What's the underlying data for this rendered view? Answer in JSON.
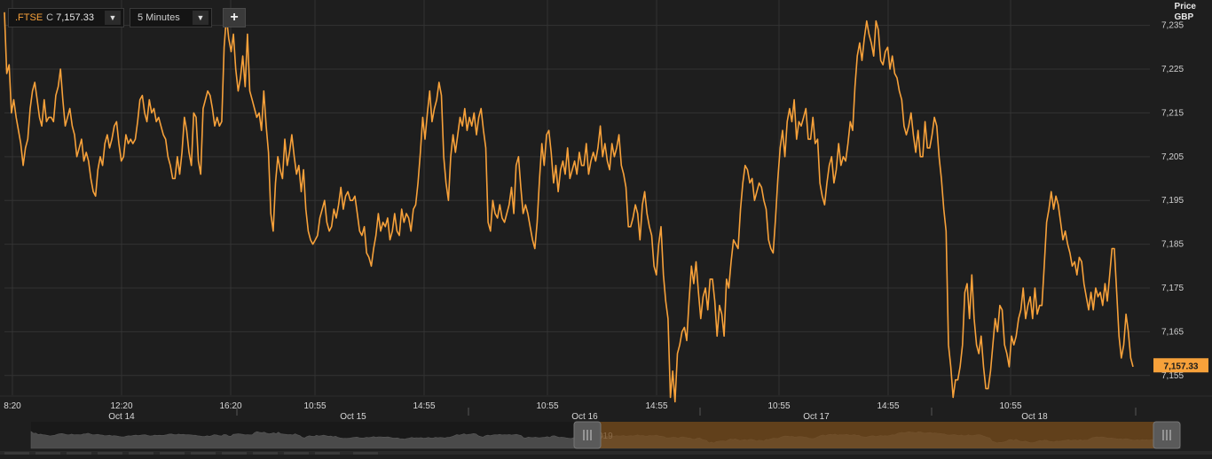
{
  "toolbar": {
    "symbol": ".FTSE",
    "close_label": "C",
    "close_value": "7,157.33",
    "interval": "5 Minutes",
    "add_icon": "plus-icon",
    "dropdown_icon": "triangle-down-icon"
  },
  "axis_header": {
    "line1": "Price",
    "line2": "GBP"
  },
  "colors": {
    "line": "#f7a13a",
    "background": "#1e1e1e",
    "grid": "#333333",
    "price_tag": "#f7a13a",
    "navigator_fill": "#7a4d1c"
  },
  "chart_data": {
    "type": "line",
    "grid": true,
    "x": [
      "08:20",
      "12:20",
      "16:20",
      "10:55",
      "14:55",
      "10:55",
      "14:55",
      "10:55",
      "14:55",
      "10:55"
    ],
    "x_tick_labels": [
      "8:20",
      "12:20",
      "16:20",
      "10:55",
      "14:55",
      "10:55",
      "14:55",
      "10:55",
      "14:55",
      "10:55"
    ],
    "x_date_labels": [
      "Oct 14",
      "Oct 15",
      "Oct 16",
      "Oct 17",
      "Oct 18"
    ],
    "yticks": [
      7155,
      7165,
      7175,
      7185,
      7195,
      7205,
      7215,
      7225,
      7235
    ],
    "ytick_labels": [
      "7,155",
      "7,165",
      "7,175",
      "7,185",
      "7,195",
      "7,205",
      "7,215",
      "7,225",
      "7,235"
    ],
    "ylim": [
      7150.5,
      7240.8
    ],
    "last_value": 7157.33,
    "last_value_label": "7,157.33",
    "series": [
      {
        "values": [
          7238,
          7224,
          7226,
          7215,
          7218,
          7214,
          7211,
          7208,
          7203,
          7207,
          7209,
          7216,
          7220,
          7222,
          7218,
          7214,
          7212,
          7218,
          7213,
          7214,
          7214,
          7213,
          7219,
          7221,
          7225,
          7218,
          7212,
          7214,
          7216,
          7212,
          7210,
          7205,
          7207,
          7209,
          7204,
          7206,
          7204,
          7200,
          7197,
          7196,
          7202,
          7205,
          7203,
          7208,
          7210,
          7207,
          7209,
          7212,
          7213,
          7208,
          7204,
          7205,
          7210,
          7208,
          7209,
          7208,
          7209,
          7213,
          7218,
          7219,
          7215,
          7213,
          7218,
          7215,
          7216,
          7213,
          7214,
          7212,
          7210,
          7209,
          7205,
          7203,
          7200,
          7200,
          7205,
          7201,
          7206,
          7214,
          7211,
          7206,
          7203,
          7215,
          7214,
          7204,
          7201,
          7216,
          7218,
          7220,
          7219,
          7216,
          7212,
          7214,
          7212,
          7213,
          7230,
          7237,
          7232,
          7229,
          7233,
          7225,
          7220,
          7223,
          7228,
          7221,
          7233,
          7220,
          7218,
          7216,
          7214,
          7215,
          7211,
          7220,
          7212,
          7206,
          7192,
          7188,
          7199,
          7205,
          7202,
          7200,
          7209,
          7203,
          7206,
          7210,
          7205,
          7201,
          7203,
          7197,
          7202,
          7193,
          7188,
          7186,
          7185,
          7186,
          7187,
          7191,
          7193,
          7195,
          7190,
          7188,
          7189,
          7193,
          7191,
          7194,
          7198,
          7193,
          7196,
          7197,
          7195,
          7195,
          7196,
          7192,
          7188,
          7187,
          7189,
          7183,
          7182,
          7180,
          7184,
          7187,
          7192,
          7188,
          7190,
          7189,
          7191,
          7186,
          7188,
          7192,
          7188,
          7187,
          7193,
          7190,
          7192,
          7191,
          7188,
          7193,
          7194,
          7199,
          7206,
          7214,
          7209,
          7215,
          7220,
          7213,
          7216,
          7218,
          7222,
          7219,
          7205,
          7199,
          7195,
          7205,
          7210,
          7206,
          7210,
          7214,
          7212,
          7216,
          7211,
          7214,
          7212,
          7215,
          7210,
          7214,
          7216,
          7211,
          7207,
          7190,
          7188,
          7195,
          7192,
          7191,
          7194,
          7191,
          7190,
          7192,
          7194,
          7198,
          7192,
          7203,
          7205,
          7198,
          7192,
          7194,
          7192,
          7189,
          7186,
          7184,
          7190,
          7200,
          7208,
          7203,
          7210,
          7211,
          7206,
          7199,
          7203,
          7197,
          7202,
          7204,
          7201,
          7207,
          7200,
          7202,
          7204,
          7201,
          7206,
          7203,
          7203,
          7208,
          7201,
          7204,
          7206,
          7204,
          7207,
          7212,
          7205,
          7208,
          7204,
          7202,
          7208,
          7205,
          7207,
          7210,
          7203,
          7201,
          7198,
          7189,
          7189,
          7191,
          7194,
          7192,
          7186,
          7194,
          7197,
          7192,
          7189,
          7187,
          7180,
          7178,
          7185,
          7189,
          7178,
          7172,
          7168,
          7150,
          7156,
          7149,
          7160,
          7162,
          7165,
          7166,
          7163,
          7172,
          7180,
          7176,
          7181,
          7174,
          7168,
          7173,
          7175,
          7170,
          7177,
          7177,
          7172,
          7164,
          7171,
          7169,
          7164,
          7177,
          7175,
          7181,
          7186,
          7185,
          7184,
          7193,
          7199,
          7203,
          7202,
          7199,
          7200,
          7195,
          7197,
          7199,
          7198,
          7195,
          7193,
          7186,
          7184,
          7183,
          7191,
          7200,
          7207,
          7211,
          7205,
          7213,
          7216,
          7213,
          7218,
          7209,
          7213,
          7212,
          7214,
          7216,
          7209,
          7209,
          7214,
          7208,
          7209,
          7199,
          7196,
          7194,
          7199,
          7203,
          7205,
          7199,
          7202,
          7208,
          7203,
          7205,
          7204,
          7208,
          7213,
          7211,
          7221,
          7228,
          7231,
          7227,
          7232,
          7236,
          7233,
          7231,
          7228,
          7236,
          7234,
          7227,
          7226,
          7229,
          7230,
          7225,
          7228,
          7224,
          7223,
          7220,
          7218,
          7212,
          7210,
          7212,
          7215,
          7210,
          7206,
          7211,
          7205,
          7205,
          7213,
          7207,
          7207,
          7210,
          7214,
          7212,
          7205,
          7200,
          7193,
          7188,
          7162,
          7157,
          7150,
          7154,
          7154,
          7157,
          7162,
          7174,
          7176,
          7168,
          7178,
          7168,
          7162,
          7160,
          7164,
          7157,
          7152,
          7152,
          7156,
          7162,
          7168,
          7165,
          7171,
          7170,
          7162,
          7160,
          7157,
          7164,
          7162,
          7164,
          7168,
          7170,
          7175,
          7168,
          7171,
          7173,
          7168,
          7175,
          7169,
          7171,
          7171,
          7180,
          7190,
          7193,
          7197,
          7193,
          7196,
          7194,
          7190,
          7186,
          7188,
          7185,
          7183,
          7180,
          7181,
          7178,
          7182,
          7181,
          7176,
          7173,
          7170,
          7174,
          7170,
          7175,
          7173,
          7174,
          7171,
          7176,
          7172,
          7178,
          7184,
          7184,
          7174,
          7164,
          7159,
          7162,
          7169,
          7165,
          7159,
          7157
        ]
      }
    ]
  },
  "navigator": {
    "handle_left": "grip-icon",
    "handle_right": "grip-icon",
    "partial_label": "019"
  }
}
